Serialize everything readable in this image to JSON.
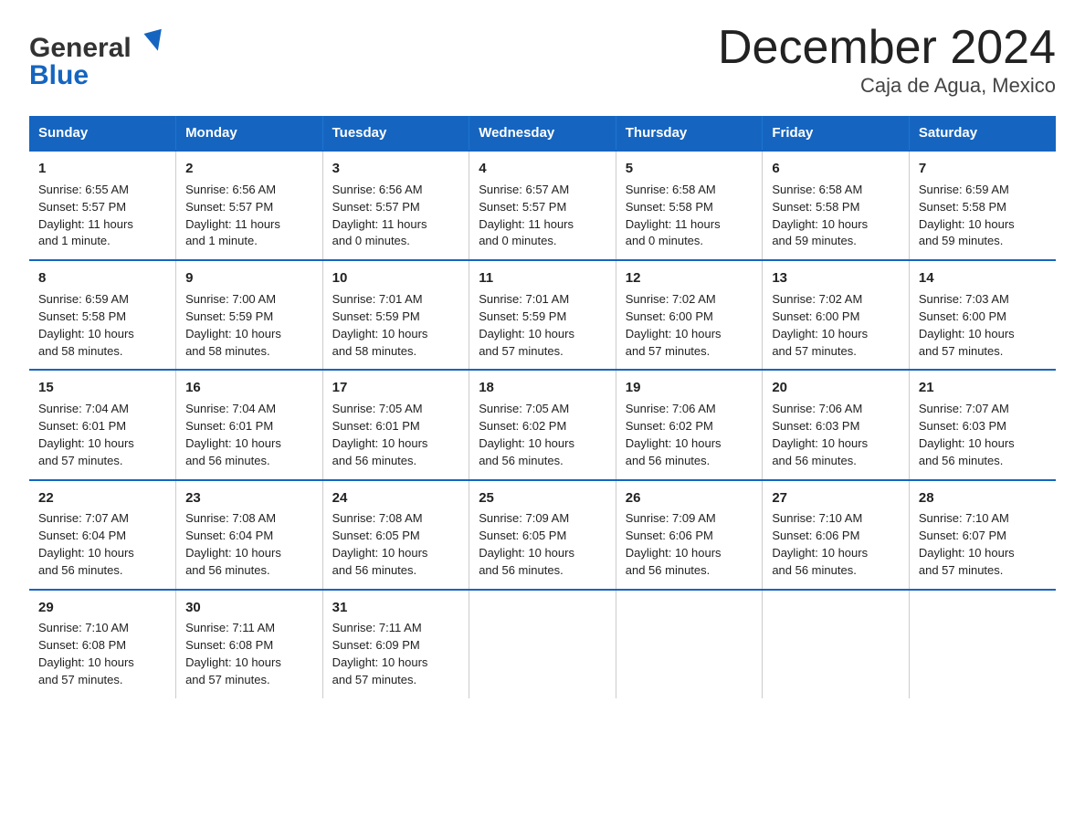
{
  "logo": {
    "general": "General",
    "blue": "Blue",
    "triangle_char": "▶"
  },
  "title": "December 2024",
  "subtitle": "Caja de Agua, Mexico",
  "days_header": [
    "Sunday",
    "Monday",
    "Tuesday",
    "Wednesday",
    "Thursday",
    "Friday",
    "Saturday"
  ],
  "weeks": [
    [
      {
        "day": "1",
        "info": "Sunrise: 6:55 AM\nSunset: 5:57 PM\nDaylight: 11 hours\nand 1 minute."
      },
      {
        "day": "2",
        "info": "Sunrise: 6:56 AM\nSunset: 5:57 PM\nDaylight: 11 hours\nand 1 minute."
      },
      {
        "day": "3",
        "info": "Sunrise: 6:56 AM\nSunset: 5:57 PM\nDaylight: 11 hours\nand 0 minutes."
      },
      {
        "day": "4",
        "info": "Sunrise: 6:57 AM\nSunset: 5:57 PM\nDaylight: 11 hours\nand 0 minutes."
      },
      {
        "day": "5",
        "info": "Sunrise: 6:58 AM\nSunset: 5:58 PM\nDaylight: 11 hours\nand 0 minutes."
      },
      {
        "day": "6",
        "info": "Sunrise: 6:58 AM\nSunset: 5:58 PM\nDaylight: 10 hours\nand 59 minutes."
      },
      {
        "day": "7",
        "info": "Sunrise: 6:59 AM\nSunset: 5:58 PM\nDaylight: 10 hours\nand 59 minutes."
      }
    ],
    [
      {
        "day": "8",
        "info": "Sunrise: 6:59 AM\nSunset: 5:58 PM\nDaylight: 10 hours\nand 58 minutes."
      },
      {
        "day": "9",
        "info": "Sunrise: 7:00 AM\nSunset: 5:59 PM\nDaylight: 10 hours\nand 58 minutes."
      },
      {
        "day": "10",
        "info": "Sunrise: 7:01 AM\nSunset: 5:59 PM\nDaylight: 10 hours\nand 58 minutes."
      },
      {
        "day": "11",
        "info": "Sunrise: 7:01 AM\nSunset: 5:59 PM\nDaylight: 10 hours\nand 57 minutes."
      },
      {
        "day": "12",
        "info": "Sunrise: 7:02 AM\nSunset: 6:00 PM\nDaylight: 10 hours\nand 57 minutes."
      },
      {
        "day": "13",
        "info": "Sunrise: 7:02 AM\nSunset: 6:00 PM\nDaylight: 10 hours\nand 57 minutes."
      },
      {
        "day": "14",
        "info": "Sunrise: 7:03 AM\nSunset: 6:00 PM\nDaylight: 10 hours\nand 57 minutes."
      }
    ],
    [
      {
        "day": "15",
        "info": "Sunrise: 7:04 AM\nSunset: 6:01 PM\nDaylight: 10 hours\nand 57 minutes."
      },
      {
        "day": "16",
        "info": "Sunrise: 7:04 AM\nSunset: 6:01 PM\nDaylight: 10 hours\nand 56 minutes."
      },
      {
        "day": "17",
        "info": "Sunrise: 7:05 AM\nSunset: 6:01 PM\nDaylight: 10 hours\nand 56 minutes."
      },
      {
        "day": "18",
        "info": "Sunrise: 7:05 AM\nSunset: 6:02 PM\nDaylight: 10 hours\nand 56 minutes."
      },
      {
        "day": "19",
        "info": "Sunrise: 7:06 AM\nSunset: 6:02 PM\nDaylight: 10 hours\nand 56 minutes."
      },
      {
        "day": "20",
        "info": "Sunrise: 7:06 AM\nSunset: 6:03 PM\nDaylight: 10 hours\nand 56 minutes."
      },
      {
        "day": "21",
        "info": "Sunrise: 7:07 AM\nSunset: 6:03 PM\nDaylight: 10 hours\nand 56 minutes."
      }
    ],
    [
      {
        "day": "22",
        "info": "Sunrise: 7:07 AM\nSunset: 6:04 PM\nDaylight: 10 hours\nand 56 minutes."
      },
      {
        "day": "23",
        "info": "Sunrise: 7:08 AM\nSunset: 6:04 PM\nDaylight: 10 hours\nand 56 minutes."
      },
      {
        "day": "24",
        "info": "Sunrise: 7:08 AM\nSunset: 6:05 PM\nDaylight: 10 hours\nand 56 minutes."
      },
      {
        "day": "25",
        "info": "Sunrise: 7:09 AM\nSunset: 6:05 PM\nDaylight: 10 hours\nand 56 minutes."
      },
      {
        "day": "26",
        "info": "Sunrise: 7:09 AM\nSunset: 6:06 PM\nDaylight: 10 hours\nand 56 minutes."
      },
      {
        "day": "27",
        "info": "Sunrise: 7:10 AM\nSunset: 6:06 PM\nDaylight: 10 hours\nand 56 minutes."
      },
      {
        "day": "28",
        "info": "Sunrise: 7:10 AM\nSunset: 6:07 PM\nDaylight: 10 hours\nand 57 minutes."
      }
    ],
    [
      {
        "day": "29",
        "info": "Sunrise: 7:10 AM\nSunset: 6:08 PM\nDaylight: 10 hours\nand 57 minutes."
      },
      {
        "day": "30",
        "info": "Sunrise: 7:11 AM\nSunset: 6:08 PM\nDaylight: 10 hours\nand 57 minutes."
      },
      {
        "day": "31",
        "info": "Sunrise: 7:11 AM\nSunset: 6:09 PM\nDaylight: 10 hours\nand 57 minutes."
      },
      null,
      null,
      null,
      null
    ]
  ]
}
